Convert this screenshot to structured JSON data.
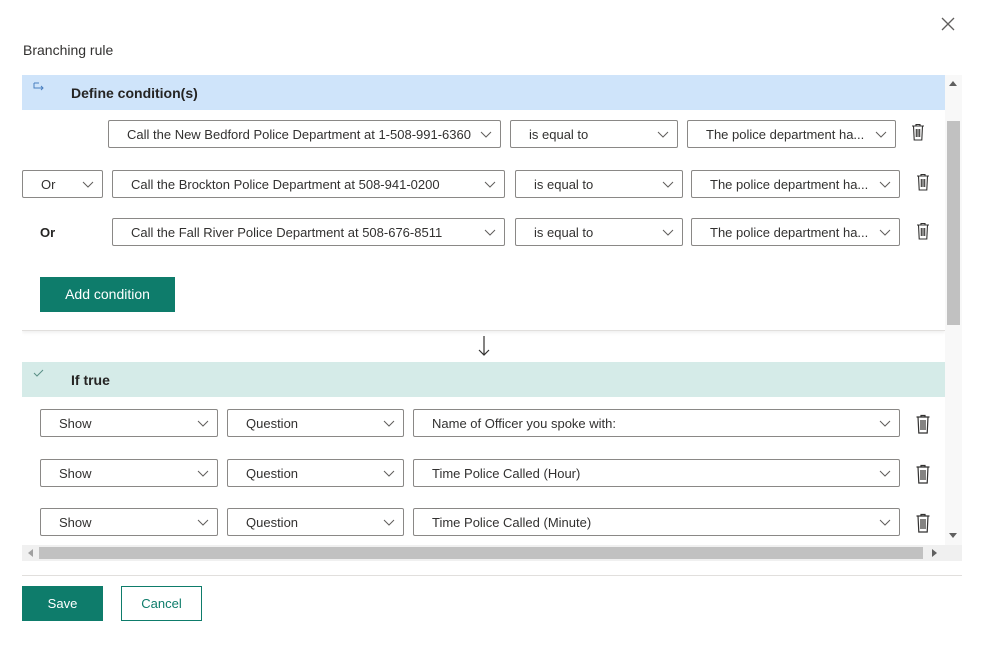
{
  "dialog": {
    "title": "Branching rule",
    "close_icon": "close-icon"
  },
  "conditions": {
    "header": "Define condition(s)",
    "rows": [
      {
        "connector": "",
        "question": "Call the New Bedford Police Department at 1-508-991-6360",
        "operator": "is equal to",
        "value": "The police department ha..."
      },
      {
        "connector": "Or",
        "question": "Call the Brockton Police Department at 508-941-0200",
        "operator": "is equal to",
        "value": "The police department ha..."
      },
      {
        "connector": "Or",
        "question": "Call the Fall River Police Department at 508-676-8511",
        "operator": "is equal to",
        "value": "The police department ha..."
      }
    ],
    "add_label": "Add condition"
  },
  "if_true": {
    "header": "If true",
    "rows": [
      {
        "action": "Show",
        "type": "Question",
        "target": "Name of Officer you spoke with:"
      },
      {
        "action": "Show",
        "type": "Question",
        "target": "Time Police Called (Hour)"
      },
      {
        "action": "Show",
        "type": "Question",
        "target": "Time Police Called (Minute)"
      }
    ]
  },
  "footer": {
    "save_label": "Save",
    "cancel_label": "Cancel"
  },
  "colors": {
    "accent": "#0e7c6b",
    "condition_header": "#cfe4fa",
    "true_header": "#d5ebe8"
  }
}
